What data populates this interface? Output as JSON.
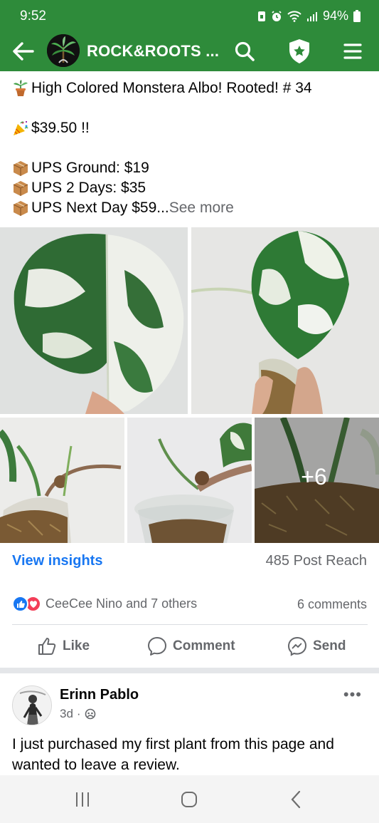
{
  "status_bar": {
    "time": "9:52",
    "battery": "94%",
    "icons": [
      "sim-icon",
      "alarm-icon",
      "wifi-icon",
      "signal-icon",
      "battery-icon"
    ]
  },
  "app_bar": {
    "page_name": "ROCK&ROOTS ...",
    "accent_color": "#2e8b3a",
    "icons": [
      "back-arrow-icon",
      "search-icon",
      "shield-star-icon",
      "menu-icon"
    ]
  },
  "post": {
    "title_line": "High Colored Monstera Albo! Rooted! # 34",
    "price_line": "$39.50 !!",
    "shipping": [
      "UPS Ground: $19",
      "UPS 2 Days: $35",
      "UPS Next Day $59..."
    ],
    "see_more": " See more",
    "photo_more_count": "+6"
  },
  "insights": {
    "link": "View insights",
    "reach": "485 Post Reach"
  },
  "reactions": {
    "names": "CeeCee Nino and 7 others",
    "comments": "6 comments"
  },
  "actions": {
    "like": "Like",
    "comment": "Comment",
    "send": "Send"
  },
  "comment": {
    "author": "Erinn Pablo",
    "time": "3d",
    "text_line_1": "I just purchased my first plant from this page and",
    "text_line_2": "wanted to leave a review."
  },
  "nav_bar": {
    "icons": [
      "recents-icon",
      "home-icon",
      "back-icon"
    ]
  }
}
